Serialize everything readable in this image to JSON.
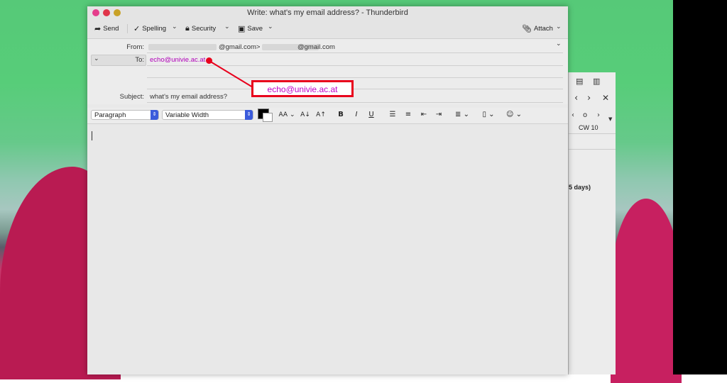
{
  "window": {
    "title": "Write: what's my email address? - Thunderbird"
  },
  "toolbar": {
    "send_label": "Send",
    "spelling_label": "Spelling",
    "security_label": "Security",
    "save_label": "Save",
    "attach_label": "Attach"
  },
  "header": {
    "from_label": "From:",
    "from_value_suffix": "@gmail.com>",
    "from_value_secondary": "@gmail.com",
    "to_label": "To:",
    "to_value": "echo@univie.ac.at",
    "subject_label": "Subject:",
    "subject_value": "what's my email address?"
  },
  "format": {
    "paragraph_label": "Paragraph",
    "font_label": "Variable Width",
    "font_size_label": "AA",
    "smaller_label": "A",
    "larger_label": "A",
    "bold_label": "B",
    "italic_label": "I",
    "underline_label": "U"
  },
  "annotation": {
    "text": "echo@univie.ac.at",
    "color": "#e8001c"
  },
  "calendar_panel": {
    "week_label": "CW 10",
    "duration_label": "5 days)"
  },
  "colors": {
    "traffic_close": "#e0354a",
    "traffic_min": "#e53d8c",
    "traffic_max": "#c9a227",
    "recipient": "#b000b8"
  }
}
